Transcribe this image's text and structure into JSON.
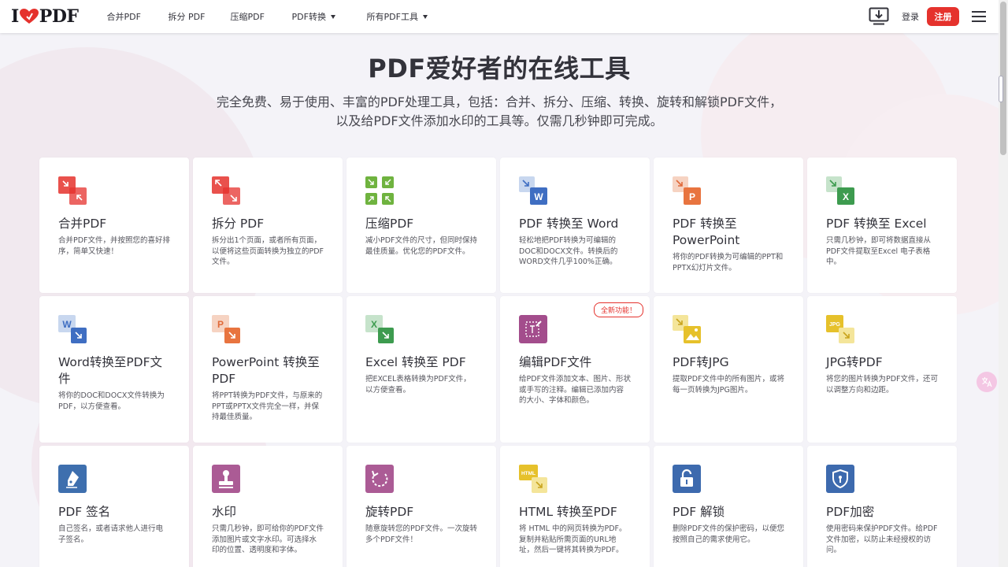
{
  "header": {
    "logo_left": "I",
    "logo_right": "PDF",
    "nav": [
      {
        "label": "合并PDF",
        "dropdown": false
      },
      {
        "label": "拆分 PDF",
        "dropdown": false
      },
      {
        "label": "压缩PDF",
        "dropdown": false
      },
      {
        "label": "PDF转换",
        "dropdown": true
      },
      {
        "label": "所有PDF工具",
        "dropdown": true
      }
    ],
    "login_label": "登录",
    "signup_label": "注册"
  },
  "hero": {
    "title": "PDF爱好者的在线工具",
    "subtitle": "完全免费、易于使用、丰富的PDF处理工具，包括：合并、拆分、压缩、转换、旋转和解锁PDF文件，以及给PDF文件添加水印的工具等。仅需几秒钟即可完成。"
  },
  "tools": [
    {
      "title": "合并PDF",
      "desc": "合并PDF文件，并按照您的喜好排序，简单又快速！",
      "icon": "merge-icon"
    },
    {
      "title": "拆分 PDF",
      "desc": "拆分出1个页面，或者所有页面，以便将这些页面转换为独立的PDF文件。",
      "icon": "split-icon"
    },
    {
      "title": "压缩PDF",
      "desc": "减小PDF文件的尺寸，但同时保持最佳质量。优化您的PDF文件。",
      "icon": "compress-icon"
    },
    {
      "title": "PDF 转换至 Word",
      "desc": "轻松地把PDF转换为可编辑的DOC和DOCX文件。转换后的WORD文件几乎100%正确。",
      "icon": "pdf-to-word-icon"
    },
    {
      "title": "PDF 转换至 PowerPoint",
      "desc": "将你的PDF转换为可编辑的PPT和PPTX幻灯片文件。",
      "icon": "pdf-to-ppt-icon"
    },
    {
      "title": "PDF 转换至 Excel",
      "desc": "只需几秒钟，即可将数据直接从PDF文件提取至Excel 电子表格中。",
      "icon": "pdf-to-excel-icon"
    },
    {
      "title": "Word转换至PDF文件",
      "desc": "将你的DOC和DOCX文件转换为PDF，以方便查看。",
      "icon": "word-to-pdf-icon"
    },
    {
      "title": "PowerPoint 转换至 PDF",
      "desc": "将PPT转换为PDF文件，与原来的PPT或PPTX文件完全一样，并保持最佳质量。",
      "icon": "ppt-to-pdf-icon"
    },
    {
      "title": "Excel 转换至 PDF",
      "desc": "把EXCEL表格转换为PDF文件，以方便查看。",
      "icon": "excel-to-pdf-icon"
    },
    {
      "title": "编辑PDF文件",
      "desc": "给PDF文件添加文本、图片、形状或手写的注释。编辑已添加内容的大小、字体和颜色。",
      "icon": "edit-pdf-icon",
      "badge": "全新功能！"
    },
    {
      "title": "PDF转JPG",
      "desc": "提取PDF文件中的所有图片，或将每一页转换为JPG图片。",
      "icon": "pdf-to-jpg-icon"
    },
    {
      "title": "JPG转PDF",
      "desc": "将您的图片转换为PDF文件，还可以调整方向和边距。",
      "icon": "jpg-to-pdf-icon"
    },
    {
      "title": "PDF 签名",
      "desc": "自己签名，或者请求他人进行电子签名。",
      "icon": "sign-icon"
    },
    {
      "title": "水印",
      "desc": "只需几秒钟，即可给你的PDF文件添加图片或文字水印。可选择水印的位置、透明度和字体。",
      "icon": "watermark-icon"
    },
    {
      "title": "旋转PDF",
      "desc": "随意旋转您的PDF文件。一次旋转多个PDF文件！",
      "icon": "rotate-icon"
    },
    {
      "title": "HTML 转换至PDF",
      "desc": "将 HTML 中的网页转换为PDF。复制并粘贴所需页面的URL地址，然后一键将其转换为PDF。",
      "icon": "html-to-pdf-icon"
    },
    {
      "title": "PDF 解锁",
      "desc": "删除PDF文件的保护密码，以便您按照自己的需求使用它。",
      "icon": "unlock-icon"
    },
    {
      "title": "PDF加密",
      "desc": "使用密码来保护PDF文件。给PDF文件加密，以防止未经授权的访问。",
      "icon": "protect-icon"
    }
  ],
  "colors": {
    "brand_red": "#e5322d",
    "merge": "#e5322d",
    "compress": "#6fb33f",
    "word": "#3f6ec2",
    "ppt": "#e06a3a",
    "excel": "#3d9b4f",
    "edit": "#a34d8c",
    "jpg": "#e6c12b",
    "sign": "#3e6fae",
    "watermark": "#ab5b95",
    "unlock": "#3d6aae"
  }
}
